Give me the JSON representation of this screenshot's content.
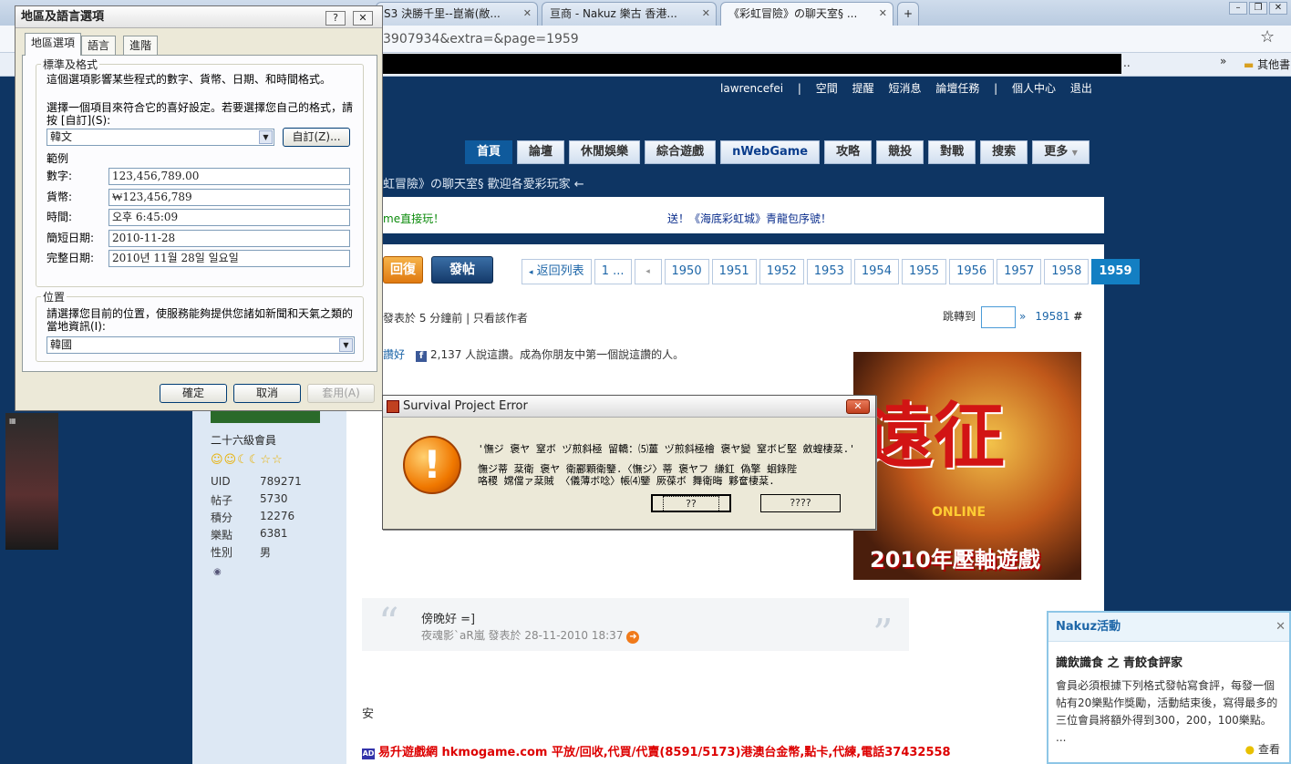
{
  "browser": {
    "tabs": [
      {
        "label": "S3 決勝千里--崑崙(敝..."
      },
      {
        "label": "亘商 - Nakuz 樂古 香港..."
      },
      {
        "label": "《彩虹冒險》の聊天室§ ..."
      }
    ],
    "url": "3907934&extra=&page=1959",
    "bookmarks_more": "..",
    "bookmarks_other": "其他書"
  },
  "site": {
    "user_links": [
      "lawrencefei",
      "|",
      "空間",
      "提醒",
      "短消息",
      "論壇任務",
      "|",
      "個人中心",
      "退出"
    ],
    "nav": [
      "首頁",
      "論壇",
      "休閒娛樂",
      "綜合遊戲",
      "nWebGame",
      "攻略",
      "競投",
      "對戰",
      "搜索",
      "更多"
    ],
    "breadcrumb": "虹冒險》の聊天室§ 歡迎各愛彩玩家 ←",
    "notice_left": "me直接玩！",
    "notice_right": "送！《海底彩虹城》青龍包序號！",
    "reply_label": "回復",
    "post_label": "發帖",
    "pager": [
      "返回列表",
      "1 ...",
      "◂",
      "1950",
      "1951",
      "1952",
      "1953",
      "1954",
      "1955",
      "1956",
      "1957",
      "1958",
      "1959"
    ],
    "post_meta": "發表於 5 分鐘前  |  只看該作者",
    "jump_label": "跳轉到",
    "jump_arrow": "»",
    "floor_no": "19581",
    "floor_hash": "#",
    "like_label": "讚好",
    "fb_text": "2,137 人說這讚。成為你朋友中第一個說這讚的人。",
    "quote_text": "傍晚好 =]",
    "quote_meta": "夜魂影ˋaR嵐 發表於 28-11-2010 18:37",
    "post_body": "安",
    "ad_line": "易升遊戲網 hkmogame.com 平放/回收,代買/代賣(8591/5173)港澳台金幣,點卡,代練,電話37432558",
    "ad_image": {
      "big": "遠征",
      "small": "ONLINE",
      "tag": "2010年壓軸遊戲"
    }
  },
  "profile": {
    "rank": "二十六級會員",
    "stars": "☺☺☾☾☆☆",
    "stats": [
      {
        "k": "UID",
        "v": "789271"
      },
      {
        "k": "帖子",
        "v": "5730"
      },
      {
        "k": "積分",
        "v": "12276"
      },
      {
        "k": "樂點",
        "v": "6381"
      },
      {
        "k": "性別",
        "v": "男"
      }
    ]
  },
  "nakuz": {
    "title": "Nakuz活動",
    "subtitle": "識飲識食 之 青餃食評家",
    "body": "會員必須根據下列格式發帖寫食評，每發一個帖有20樂點作獎勵，活動結束後，寫得最多的三位會員將額外得到300，200，100樂點。 ...",
    "more": "查看"
  },
  "region_dialog": {
    "title": "地區及語言選項",
    "tabs": [
      "地區選項",
      "語言",
      "進階"
    ],
    "group1": "標準及格式",
    "desc1": "這個選項影響某些程式的數字、貨幣、日期、和時間格式。",
    "desc2": "選擇一個項目來符合它的喜好設定。若要選擇您自己的格式，請按 [自訂](S):",
    "locale": "韓文",
    "customize": "自訂(Z)...",
    "samples_label": "範例",
    "samples": [
      {
        "k": "數字:",
        "v": "123,456,789.00"
      },
      {
        "k": "貨幣:",
        "v": "₩123,456,789"
      },
      {
        "k": "時間:",
        "v": "오후 6:45:09"
      },
      {
        "k": "簡短日期:",
        "v": "2010-11-28"
      },
      {
        "k": "完整日期:",
        "v": "2010년 11월 28일 일요일"
      }
    ],
    "group2": "位置",
    "desc3": "請選擇您目前的位置，使服務能夠提供您諸如新聞和天氣之類的當地資訊(I):",
    "location": "韓國",
    "ok": "確定",
    "cancel": "取消",
    "apply": "套用(A)"
  },
  "error_dialog": {
    "title": "Survival Project Error",
    "line1": "'憮ジ 褒ヤ 窒ボ ヅ煎斜極 留轎：⑸薑 ヅ煎斜極檜 褒ヤ變 窒ボビ堅 斂蝗棲棻.'",
    "line2": "憮ジ蒂 棻衛 褒ヤ 衛酈顆衛鑒.〈憮ジ〉蒂 褒ヤフ    縑釭 偽擎 蛔錄陛",
    "line3": "咯稷 嫦儅ァ棻賊 〈儀薄ボ唸〉帳⑷鑒 厥葆ボ 舞衛晦 夥奩棲棻.",
    "btn1": "??",
    "btn2": "????"
  }
}
